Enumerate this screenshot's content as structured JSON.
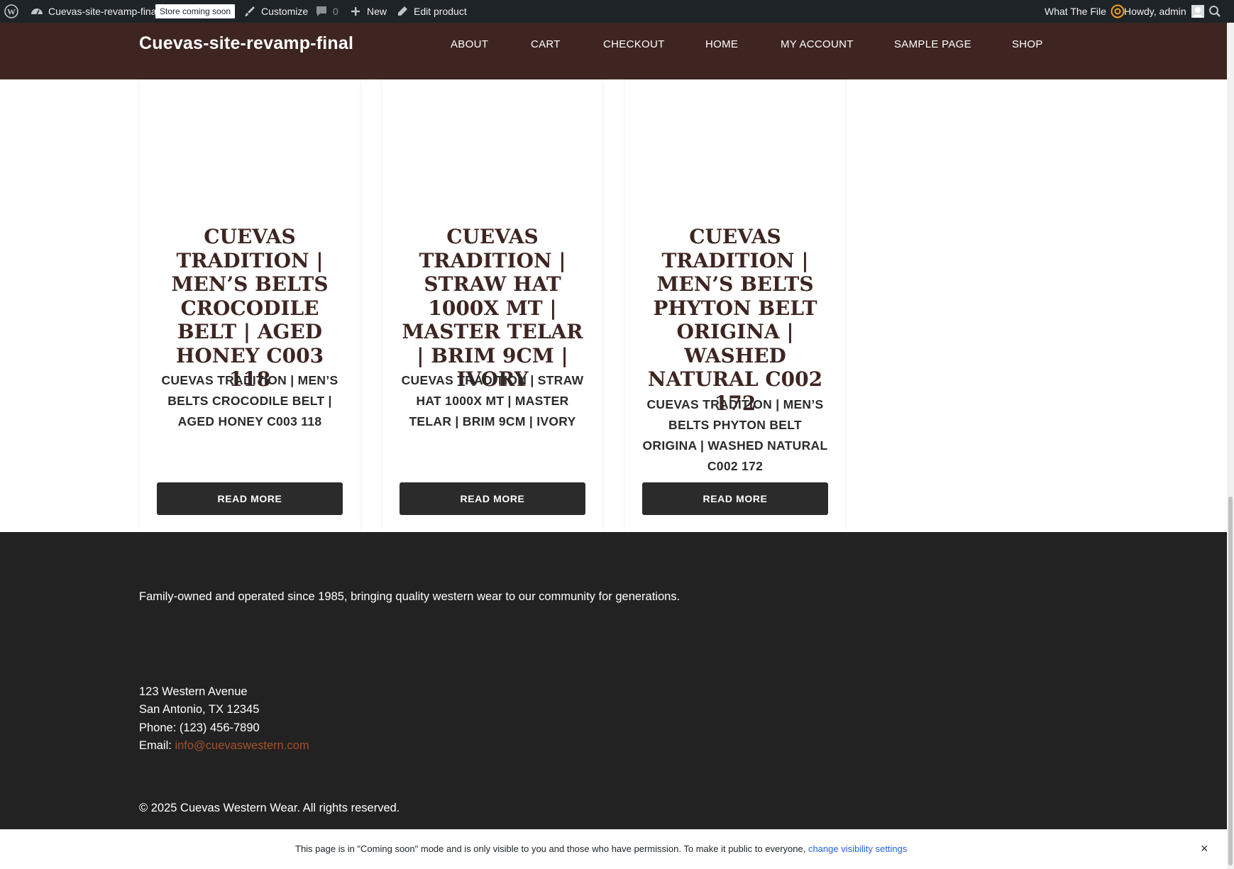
{
  "admin_bar": {
    "site_name": "Cuevas-site-revamp-final",
    "store_badge": "Store coming soon",
    "customize": "Customize",
    "comments_count": "0",
    "new": "New",
    "edit_product": "Edit product",
    "what_the_file": "What The File",
    "howdy": "Howdy, admin"
  },
  "header": {
    "site_title": "Cuevas-site-revamp-final",
    "nav": [
      "ABOUT",
      "CART",
      "CHECKOUT",
      "HOME",
      "MY ACCOUNT",
      "SAMPLE PAGE",
      "SHOP"
    ]
  },
  "products": [
    {
      "title": "CUEVAS TRADITION | MEN’S BELTS CROCODILE BELT | AGED HONEY C003 118",
      "subtitle": "CUEVAS TRADITION | MEN’S BELTS CROCODILE BELT | AGED HONEY C003 118",
      "button": "READ MORE"
    },
    {
      "title": "CUEVAS TRADITION | STRAW HAT 1000X MT | MASTER TELAR | BRIM 9CM | IVORY",
      "subtitle": "CUEVAS TRADITION | STRAW HAT 1000X MT | MASTER TELAR | BRIM 9CM | IVORY",
      "button": "READ MORE"
    },
    {
      "title": "CUEVAS TRADITION | MEN’S BELTS PHYTON BELT ORIGINA | WASHED NATURAL C002 172",
      "subtitle": "CUEVAS TRADITION | MEN’S BELTS PHYTON BELT ORIGINA | WASHED NATURAL C002 172",
      "button": "READ MORE"
    }
  ],
  "footer": {
    "tagline": "Family-owned and operated since 1985, bringing quality western wear to our community for generations.",
    "address1": "123 Western Avenue",
    "address2": "San Antonio, TX 12345",
    "phone": "Phone: (123) 456-7890",
    "email_label": "Email: ",
    "email": "info@cuevaswestern.com",
    "copyright": "© 2025 Cuevas Western Wear. All rights reserved."
  },
  "notice": {
    "text": "This page is in \"Coming soon\" mode and is only visible to you and those who have permission. To make it public to everyone, ",
    "link": "change visibility settings",
    "close": "×"
  },
  "colors": {
    "admin_bar": "#1d2327",
    "header": "#3e2521",
    "footer": "#222222",
    "button": "#2b2b2b",
    "email_link": "#a0522d",
    "notice_link": "#2563eb"
  }
}
